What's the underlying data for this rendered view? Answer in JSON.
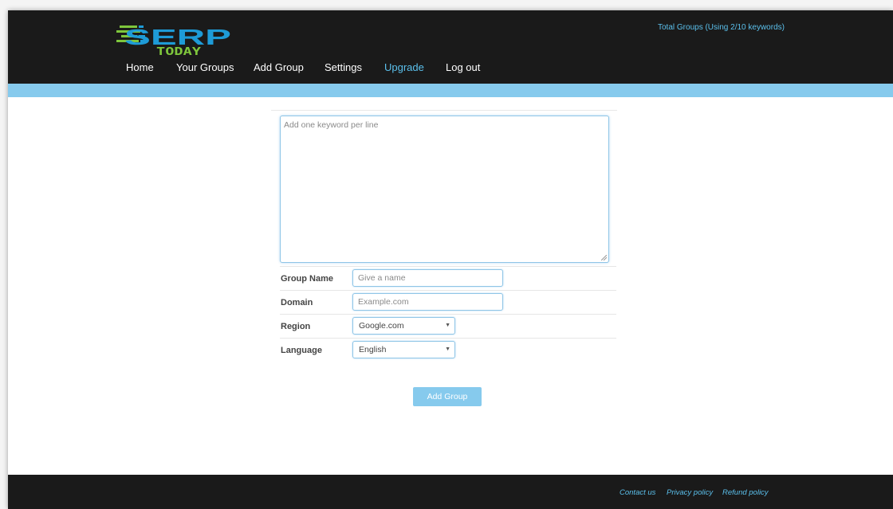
{
  "brand": {
    "logo_text": "SERP",
    "logo_subtext": "TODAY"
  },
  "nav": {
    "items": [
      {
        "label": "Home"
      },
      {
        "label": "Your Groups"
      },
      {
        "label": "Add Group"
      },
      {
        "label": "Settings"
      },
      {
        "label": "Upgrade"
      },
      {
        "label": "Log out"
      }
    ]
  },
  "usage_text": "Total Groups (Using 2/10 keywords)",
  "form": {
    "keywords_placeholder": "Add one keyword per line",
    "group_name": {
      "label": "Group Name",
      "placeholder": "Give a name",
      "value": ""
    },
    "domain": {
      "label": "Domain",
      "placeholder": "Example.com",
      "value": ""
    },
    "region": {
      "label": "Region",
      "selected": "Google.com"
    },
    "language": {
      "label": "Language",
      "selected": "English"
    },
    "submit_label": "Add Group"
  },
  "footer": {
    "links": [
      {
        "label": "Contact us"
      },
      {
        "label": "Privacy policy"
      },
      {
        "label": "Refund policy"
      }
    ]
  },
  "colors": {
    "header_bg": "#1a1a1a",
    "accent": "#5bc0ec",
    "strip": "#86caed",
    "logo_green": "#7ec63c",
    "logo_blue": "#1e9bd7"
  }
}
